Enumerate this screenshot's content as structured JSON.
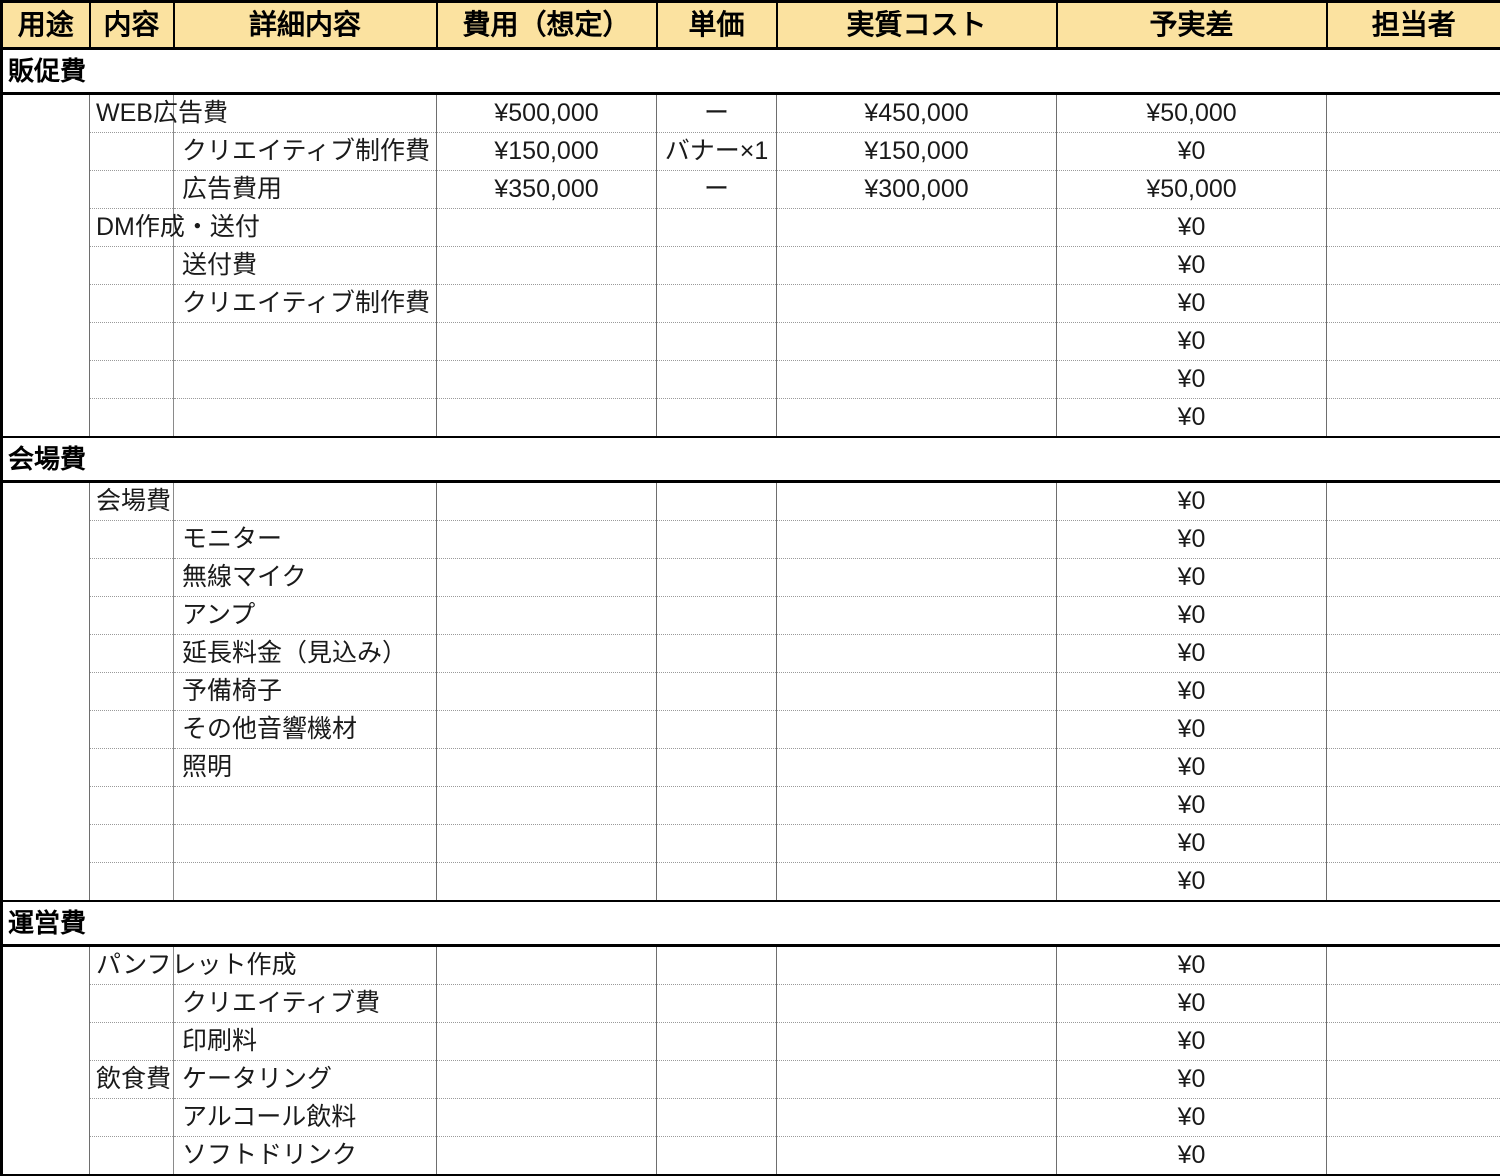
{
  "table": {
    "columns": [
      {
        "key": "use",
        "label": "用途"
      },
      {
        "key": "cat",
        "label": "内容"
      },
      {
        "key": "detail",
        "label": "詳細内容"
      },
      {
        "key": "budget",
        "label": "費用（想定）"
      },
      {
        "key": "unit",
        "label": "単価"
      },
      {
        "key": "actual",
        "label": "実質コスト"
      },
      {
        "key": "diff",
        "label": "予実差"
      },
      {
        "key": "owner",
        "label": "担当者"
      }
    ],
    "header_bg": "#fbe2a0",
    "sections": [
      {
        "title": "販促費",
        "rows": [
          {
            "level": 1,
            "cat": "WEB広告費",
            "detail": "",
            "budget": "¥500,000",
            "unit": "ー",
            "actual": "¥450,000",
            "diff": "¥50,000",
            "owner": ""
          },
          {
            "level": 2,
            "cat": "",
            "detail": "クリエイティブ制作費",
            "budget": "¥150,000",
            "unit": "バナー×1",
            "actual": "¥150,000",
            "diff": "¥0",
            "owner": ""
          },
          {
            "level": 2,
            "cat": "",
            "detail": "広告費用",
            "budget": "¥350,000",
            "unit": "ー",
            "actual": "¥300,000",
            "diff": "¥50,000",
            "owner": ""
          },
          {
            "level": 1,
            "cat": "DM作成・送付",
            "detail": "",
            "budget": "",
            "unit": "",
            "actual": "",
            "diff": "¥0",
            "owner": ""
          },
          {
            "level": 2,
            "cat": "",
            "detail": "送付費",
            "budget": "",
            "unit": "",
            "actual": "",
            "diff": "¥0",
            "owner": ""
          },
          {
            "level": 2,
            "cat": "",
            "detail": "クリエイティブ制作費",
            "budget": "",
            "unit": "",
            "actual": "",
            "diff": "¥0",
            "owner": ""
          },
          {
            "level": 2,
            "cat": "",
            "detail": "",
            "budget": "",
            "unit": "",
            "actual": "",
            "diff": "¥0",
            "owner": ""
          },
          {
            "level": 2,
            "cat": "",
            "detail": "",
            "budget": "",
            "unit": "",
            "actual": "",
            "diff": "¥0",
            "owner": ""
          },
          {
            "level": 2,
            "cat": "",
            "detail": "",
            "budget": "",
            "unit": "",
            "actual": "",
            "diff": "¥0",
            "owner": ""
          }
        ]
      },
      {
        "title": "会場費",
        "rows": [
          {
            "level": 1,
            "cat": "会場費",
            "detail": "",
            "budget": "",
            "unit": "",
            "actual": "",
            "diff": "¥0",
            "owner": ""
          },
          {
            "level": 2,
            "cat": "",
            "detail": "モニター",
            "budget": "",
            "unit": "",
            "actual": "",
            "diff": "¥0",
            "owner": ""
          },
          {
            "level": 2,
            "cat": "",
            "detail": "無線マイク",
            "budget": "",
            "unit": "",
            "actual": "",
            "diff": "¥0",
            "owner": ""
          },
          {
            "level": 2,
            "cat": "",
            "detail": "アンプ",
            "budget": "",
            "unit": "",
            "actual": "",
            "diff": "¥0",
            "owner": ""
          },
          {
            "level": 2,
            "cat": "",
            "detail": "延長料金（見込み）",
            "budget": "",
            "unit": "",
            "actual": "",
            "diff": "¥0",
            "owner": ""
          },
          {
            "level": 2,
            "cat": "",
            "detail": "予備椅子",
            "budget": "",
            "unit": "",
            "actual": "",
            "diff": "¥0",
            "owner": ""
          },
          {
            "level": 2,
            "cat": "",
            "detail": "その他音響機材",
            "budget": "",
            "unit": "",
            "actual": "",
            "diff": "¥0",
            "owner": ""
          },
          {
            "level": 2,
            "cat": "",
            "detail": "照明",
            "budget": "",
            "unit": "",
            "actual": "",
            "diff": "¥0",
            "owner": ""
          },
          {
            "level": 2,
            "cat": "",
            "detail": "",
            "budget": "",
            "unit": "",
            "actual": "",
            "diff": "¥0",
            "owner": ""
          },
          {
            "level": 2,
            "cat": "",
            "detail": "",
            "budget": "",
            "unit": "",
            "actual": "",
            "diff": "¥0",
            "owner": ""
          },
          {
            "level": 2,
            "cat": "",
            "detail": "",
            "budget": "",
            "unit": "",
            "actual": "",
            "diff": "¥0",
            "owner": ""
          }
        ]
      },
      {
        "title": "運営費",
        "rows": [
          {
            "level": 1,
            "cat": "パンフレット作成",
            "detail": "",
            "budget": "",
            "unit": "",
            "actual": "",
            "diff": "¥0",
            "owner": ""
          },
          {
            "level": 2,
            "cat": "",
            "detail": "クリエイティブ費",
            "budget": "",
            "unit": "",
            "actual": "",
            "diff": "¥0",
            "owner": ""
          },
          {
            "level": 2,
            "cat": "",
            "detail": "印刷料",
            "budget": "",
            "unit": "",
            "actual": "",
            "diff": "¥0",
            "owner": ""
          },
          {
            "level": 1,
            "cat": "飲食費",
            "detail": "ケータリング",
            "budget": "",
            "unit": "",
            "actual": "",
            "diff": "¥0",
            "owner": ""
          },
          {
            "level": 2,
            "cat": "",
            "detail": "アルコール飲料",
            "budget": "",
            "unit": "",
            "actual": "",
            "diff": "¥0",
            "owner": ""
          },
          {
            "level": 2,
            "cat": "",
            "detail": "ソフトドリンク",
            "budget": "",
            "unit": "",
            "actual": "",
            "diff": "¥0",
            "owner": ""
          }
        ]
      }
    ]
  }
}
